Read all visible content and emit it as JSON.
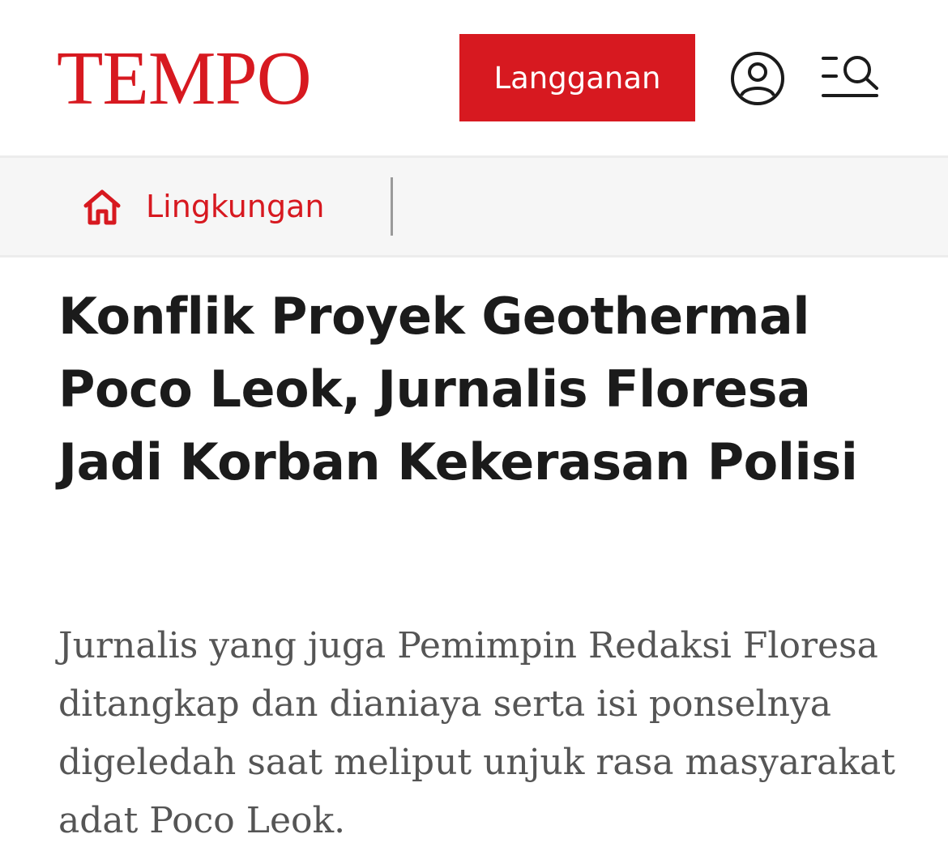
{
  "header": {
    "logo_text": "TEMPO",
    "subscribe_label": "Langganan",
    "profile_icon": "user-circle-icon",
    "search_menu_icon": "menu-search-icon",
    "brand_color": "#d71920"
  },
  "breadcrumb": {
    "home_icon": "home-icon",
    "category": "Lingkungan"
  },
  "article": {
    "headline": "Konflik Proyek Geothermal Poco Leok, Jurnalis Floresa Jadi Korban Kekerasan Polisi",
    "lead": "Jurnalis yang juga Pemimpin Redaksi Floresa ditangkap dan dianiaya serta isi ponselnya digeledah saat meliput unjuk rasa masyarakat adat Poco Leok."
  }
}
